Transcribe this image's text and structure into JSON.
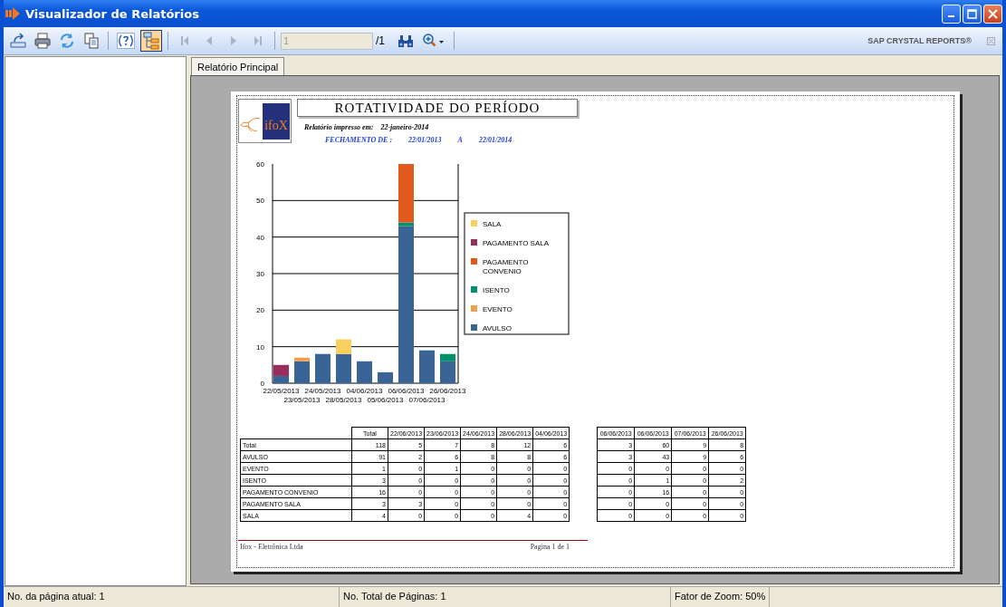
{
  "window": {
    "title": "Visualizador de Relatórios"
  },
  "toolbar": {
    "groups": [
      [
        {
          "kind": "export",
          "on": false,
          "disabled": false
        },
        {
          "kind": "print",
          "on": false,
          "disabled": false
        },
        {
          "kind": "refresh",
          "on": false,
          "disabled": false
        },
        {
          "kind": "copy",
          "on": false,
          "disabled": false
        }
      ],
      [
        {
          "kind": "help",
          "on": false,
          "disabled": false
        },
        {
          "kind": "group-tree",
          "on": true,
          "disabled": false
        }
      ],
      [
        {
          "kind": "first",
          "on": false,
          "disabled": true
        },
        {
          "kind": "previous",
          "on": false,
          "disabled": true
        },
        {
          "kind": "next",
          "on": false,
          "disabled": true
        },
        {
          "kind": "last",
          "on": false,
          "disabled": true
        }
      ]
    ],
    "page_field": {
      "value": "1"
    },
    "page_total": "/1",
    "tools": [
      {
        "kind": "search",
        "on": false,
        "disabled": false
      },
      {
        "kind": "zoom",
        "on": false,
        "disabled": false
      }
    ],
    "brand": "SAP CRYSTAL REPORTS®"
  },
  "tabs": [
    {
      "label": "Relatório Principal",
      "selected": true
    }
  ],
  "report": {
    "logo_text": "ifoX",
    "title": "ROTATIVIDADE DO PERÍODO",
    "printed_label": "Relatório impresso em:",
    "printed_date": "22-janeiro-2014",
    "period_label": "FECHAMENTO DE :",
    "period_start": "22/01/2013",
    "period_separator": "A",
    "period_end": "22/01/2014",
    "chart": {
      "chart_data": {
        "type": "bar",
        "stacked": true,
        "categories": [
          "22/05/2013",
          "23/05/2013",
          "24/05/2013",
          "28/05/2013",
          "04/06/2013",
          "05/06/2013",
          "06/06/2013",
          "07/06/2013",
          "26/06/2013"
        ],
        "ylim": [
          0,
          60
        ],
        "grid": true,
        "legend": "right",
        "yticks": [
          0,
          10,
          20,
          30,
          40,
          50,
          60
        ],
        "series": [
          {
            "name": "AVULSO",
            "color": "#3a6496",
            "values": [
              2,
              6,
              8,
              8,
              6,
              3,
              43,
              9,
              6
            ]
          },
          {
            "name": "EVENTO",
            "color": "#f0a050",
            "values": [
              0,
              1,
              0,
              0,
              0,
              0,
              0,
              0,
              0
            ]
          },
          {
            "name": "ISENTO",
            "color": "#00906c",
            "values": [
              0,
              0,
              0,
              0,
              0,
              0,
              1,
              0,
              2
            ]
          },
          {
            "name": "PAGAMENTO CONVENIO",
            "color": "#e05a20",
            "values": [
              0,
              0,
              0,
              0,
              0,
              0,
              16,
              0,
              0
            ]
          },
          {
            "name": "PAGAMENTO SALA",
            "color": "#9b2d5e",
            "values": [
              3,
              0,
              0,
              0,
              0,
              0,
              0,
              0,
              0
            ]
          },
          {
            "name": "SALA",
            "color": "#f9cf5d",
            "values": [
              0,
              0,
              0,
              4,
              0,
              0,
              0,
              0,
              0
            ]
          }
        ]
      }
    },
    "table": {
      "columns": [
        "Total",
        "22/06/2013",
        "23/06/2013",
        "24/06/2013",
        "28/06/2013",
        "04/06/2013"
      ],
      "rows": [
        {
          "label": "Total",
          "values": [
            "118",
            "5",
            "7",
            "8",
            "12",
            "6"
          ]
        },
        {
          "label": "AVULSO",
          "values": [
            "91",
            "2",
            "6",
            "8",
            "8",
            "6"
          ]
        },
        {
          "label": "EVENTO",
          "values": [
            "1",
            "0",
            "1",
            "0",
            "0",
            "0"
          ]
        },
        {
          "label": "ISENTO",
          "values": [
            "3",
            "0",
            "0",
            "0",
            "0",
            "0"
          ]
        },
        {
          "label": "PAGAMENTO CONVENIO",
          "values": [
            "16",
            "0",
            "0",
            "0",
            "0",
            "0"
          ]
        },
        {
          "label": "PAGAMENTO SALA",
          "values": [
            "3",
            "3",
            "0",
            "0",
            "0",
            "0"
          ]
        },
        {
          "label": "SALA",
          "values": [
            "4",
            "0",
            "0",
            "0",
            "4",
            "0"
          ]
        }
      ]
    },
    "table_2": {
      "columns": [
        "06/06/2013",
        "06/06/2013",
        "07/06/2013",
        "26/06/2013"
      ],
      "rows": [
        [
          "3",
          "60",
          "9",
          "8"
        ],
        [
          "3",
          "43",
          "9",
          "6"
        ],
        [
          "0",
          "0",
          "0",
          "0"
        ],
        [
          "0",
          "1",
          "0",
          "2"
        ],
        [
          "0",
          "16",
          "0",
          "0"
        ],
        [
          "0",
          "0",
          "0",
          "0"
        ],
        [
          "0",
          "0",
          "0",
          "0"
        ]
      ]
    },
    "footer_left": "Ifox - Eletrônica Ltda",
    "footer_right": "Pagina 1 de 1"
  },
  "status_bar": [
    "No. da página atual: 1",
    "No. Total de Páginas: 1",
    "Fator de Zoom: 50%"
  ]
}
